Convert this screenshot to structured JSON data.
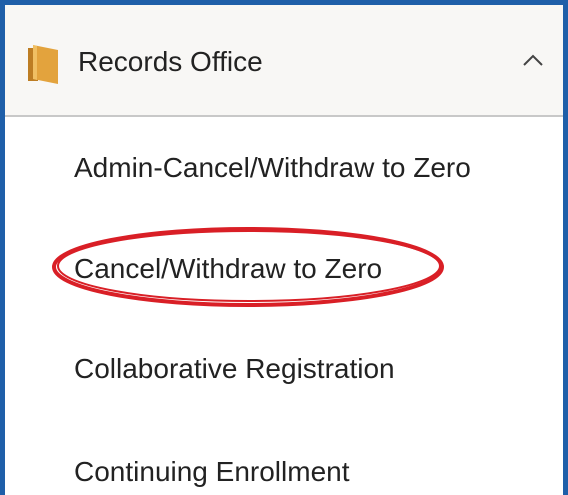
{
  "section": {
    "title": "Records Office",
    "folder_icon": "folder-icon",
    "chevron_icon": "chevron-up-icon",
    "expanded": true
  },
  "menu": {
    "items": [
      {
        "label": "Admin-Cancel/Withdraw to Zero"
      },
      {
        "label": "Cancel/Withdraw to Zero",
        "highlighted": true
      },
      {
        "label": "Collaborative Registration"
      },
      {
        "label": "Continuing Enrollment"
      }
    ]
  },
  "colors": {
    "frame_border": "#1f5fa9",
    "header_bg": "#f8f7f5",
    "folder_icon": "#e3a33d",
    "highlight_oval": "#d91f26",
    "text": "#222222"
  }
}
